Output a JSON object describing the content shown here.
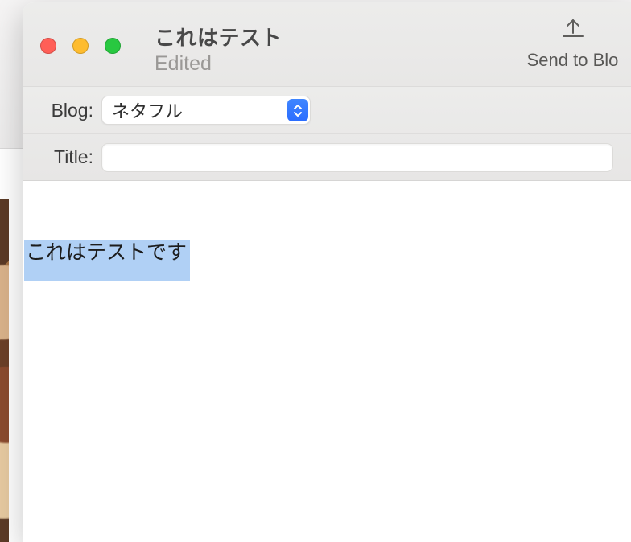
{
  "window": {
    "title": "これはテスト",
    "subtitle": "Edited"
  },
  "toolbar": {
    "send_label": "Send to Blo"
  },
  "form": {
    "blog_label": "Blog:",
    "blog_value": "ネタフル",
    "title_label": "Title:",
    "title_value": ""
  },
  "editor": {
    "selected_text": "これはテストです"
  }
}
